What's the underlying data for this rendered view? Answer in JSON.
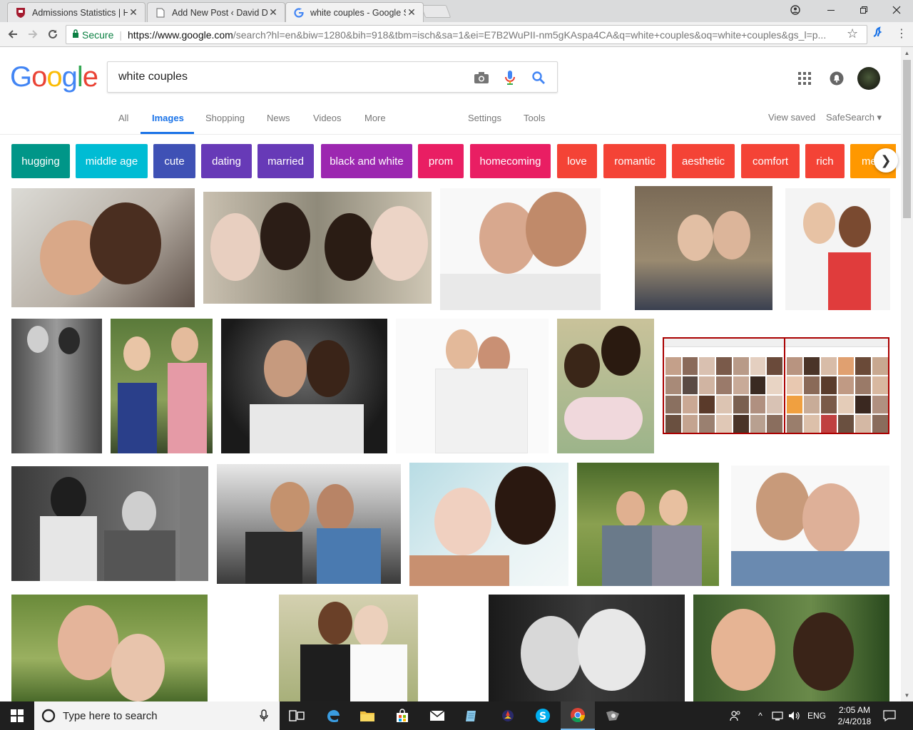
{
  "browser": {
    "tabs": [
      {
        "title": "Admissions Statistics | Ha",
        "icon": "harvard-shield-icon",
        "active": false
      },
      {
        "title": "Add New Post ‹ David Du",
        "icon": "page-icon",
        "active": false
      },
      {
        "title": "white couples - Google S",
        "icon": "google-g-icon",
        "active": true
      }
    ],
    "close_glyph": "✕",
    "secure_label": "Secure",
    "url_host": "https://www.google.com",
    "url_rest": "/search?hl=en&biw=1280&bih=918&tbm=isch&sa=1&ei=E7B2WuPII-nm5gKAspa4CA&q=white+couples&oq=white+couples&gs_l=p..."
  },
  "google": {
    "logo_letters": [
      "G",
      "o",
      "o",
      "g",
      "l",
      "e"
    ],
    "logo_colors": [
      "#4285f4",
      "#ea4335",
      "#fbbc05",
      "#4285f4",
      "#34a853",
      "#ea4335"
    ],
    "query": "white couples",
    "nav": {
      "all": "All",
      "images": "Images",
      "shopping": "Shopping",
      "news": "News",
      "videos": "Videos",
      "more": "More",
      "settings": "Settings",
      "tools": "Tools",
      "view_saved": "View saved",
      "safesearch": "SafeSearch ▾"
    }
  },
  "chips": [
    {
      "label": "hugging",
      "color": "#009688"
    },
    {
      "label": "middle age",
      "color": "#00bcd4"
    },
    {
      "label": "cute",
      "color": "#3f51b5"
    },
    {
      "label": "dating",
      "color": "#673ab7"
    },
    {
      "label": "married",
      "color": "#673ab7"
    },
    {
      "label": "black and white",
      "color": "#9c27b0"
    },
    {
      "label": "prom",
      "color": "#e91e63"
    },
    {
      "label": "homecoming",
      "color": "#e91e63"
    },
    {
      "label": "love",
      "color": "#f44336"
    },
    {
      "label": "romantic",
      "color": "#f44336"
    },
    {
      "label": "aesthetic",
      "color": "#f44336"
    },
    {
      "label": "comfort",
      "color": "#f44336"
    },
    {
      "label": "rich",
      "color": "#f44336"
    },
    {
      "label": "mexican",
      "color": "#ff9800"
    }
  ],
  "taskbar": {
    "search_placeholder": "Type here to search",
    "language": "ENG",
    "time": "2:05 AM",
    "date": "2/4/2018"
  }
}
